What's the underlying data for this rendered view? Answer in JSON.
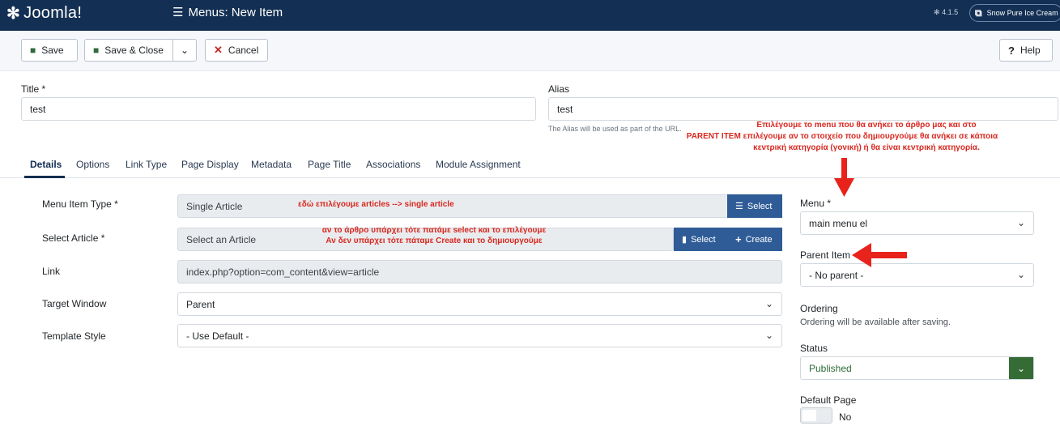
{
  "header": {
    "logo_text": "Joomla!",
    "page_title": "Menus: New Item",
    "version": "4.1.5",
    "site_name": "Snow Pure Ice Cream"
  },
  "toolbar": {
    "save_label": "Save",
    "save_close_label": "Save & Close",
    "cancel_label": "Cancel",
    "help_label": "Help"
  },
  "form": {
    "title_label": "Title *",
    "title_value": "test",
    "alias_label": "Alias",
    "alias_value": "test",
    "alias_help": "The Alias will be used as part of the URL."
  },
  "tabs": [
    {
      "label": "Details"
    },
    {
      "label": "Options"
    },
    {
      "label": "Link Type"
    },
    {
      "label": "Page Display"
    },
    {
      "label": "Metadata"
    },
    {
      "label": "Page Title"
    },
    {
      "label": "Associations"
    },
    {
      "label": "Module Assignment"
    }
  ],
  "details": {
    "menu_item_type_label": "Menu Item Type *",
    "menu_item_type_value": "Single Article",
    "select_label": "Select",
    "select_article_label": "Select Article *",
    "select_article_value": "Select an Article",
    "select_article_select": "Select",
    "select_article_create": "Create",
    "link_label": "Link",
    "link_value": "index.php?option=com_content&view=article",
    "target_window_label": "Target Window",
    "target_window_value": "Parent",
    "template_style_label": "Template Style",
    "template_style_value": "- Use Default -"
  },
  "sidebar": {
    "menu_label": "Menu *",
    "menu_value": "main menu el",
    "parent_label": "Parent Item",
    "parent_value": "- No parent -",
    "ordering_label": "Ordering",
    "ordering_help": "Ordering will be available after saving.",
    "status_label": "Status",
    "status_value": "Published",
    "default_page_label": "Default Page",
    "default_page_value": "No"
  },
  "annotations": {
    "top_line1": "Επιλέγουμε το menu που θα ανήκει το άρθρο μας και στο",
    "top_line2": "PARENT ITEM επιλέγουμε αν το στοιχείο που δημιουργούμε θα ανήκει σε κάποια",
    "top_line3": "κεντρική κατηγορία (γονική) ή θα είναι κεντρική κατηγορία.",
    "type_note": "εδώ επιλέγουμε articles --> single article",
    "article_line1": "αν το άρθρο υπάρχει τότε πατάμε select και το επιλέγουμε",
    "article_line2": "Αν δεν υπάρχει τότε πάταμε Create και το δημιουργούμε"
  },
  "colors": {
    "header_bg": "#132f53",
    "select_btn": "#2f5c97",
    "annotation_red": "#d8281f",
    "status_green": "#356c36"
  }
}
